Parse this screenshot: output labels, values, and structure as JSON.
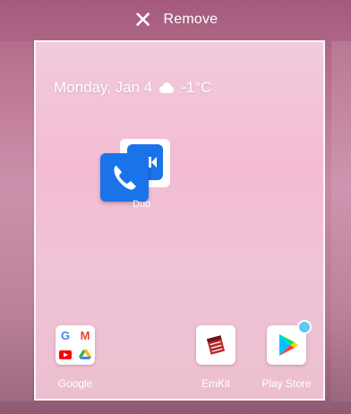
{
  "topbar": {
    "remove_label": "Remove"
  },
  "homescreen": {
    "date_text": "Monday, Jan 4",
    "temperature": "-1°C",
    "weather_icon": "cloud-icon"
  },
  "apps": {
    "duo": {
      "label": "Duo"
    },
    "google": {
      "label": "Google"
    },
    "emkit": {
      "label": "EmKit"
    },
    "playstore": {
      "label": "Play Store"
    }
  },
  "colors": {
    "background": "#b9708f",
    "page_bg": "#f2cbdc",
    "duo_blue": "#1a73e8",
    "badge_blue": "#5ec8f2"
  }
}
